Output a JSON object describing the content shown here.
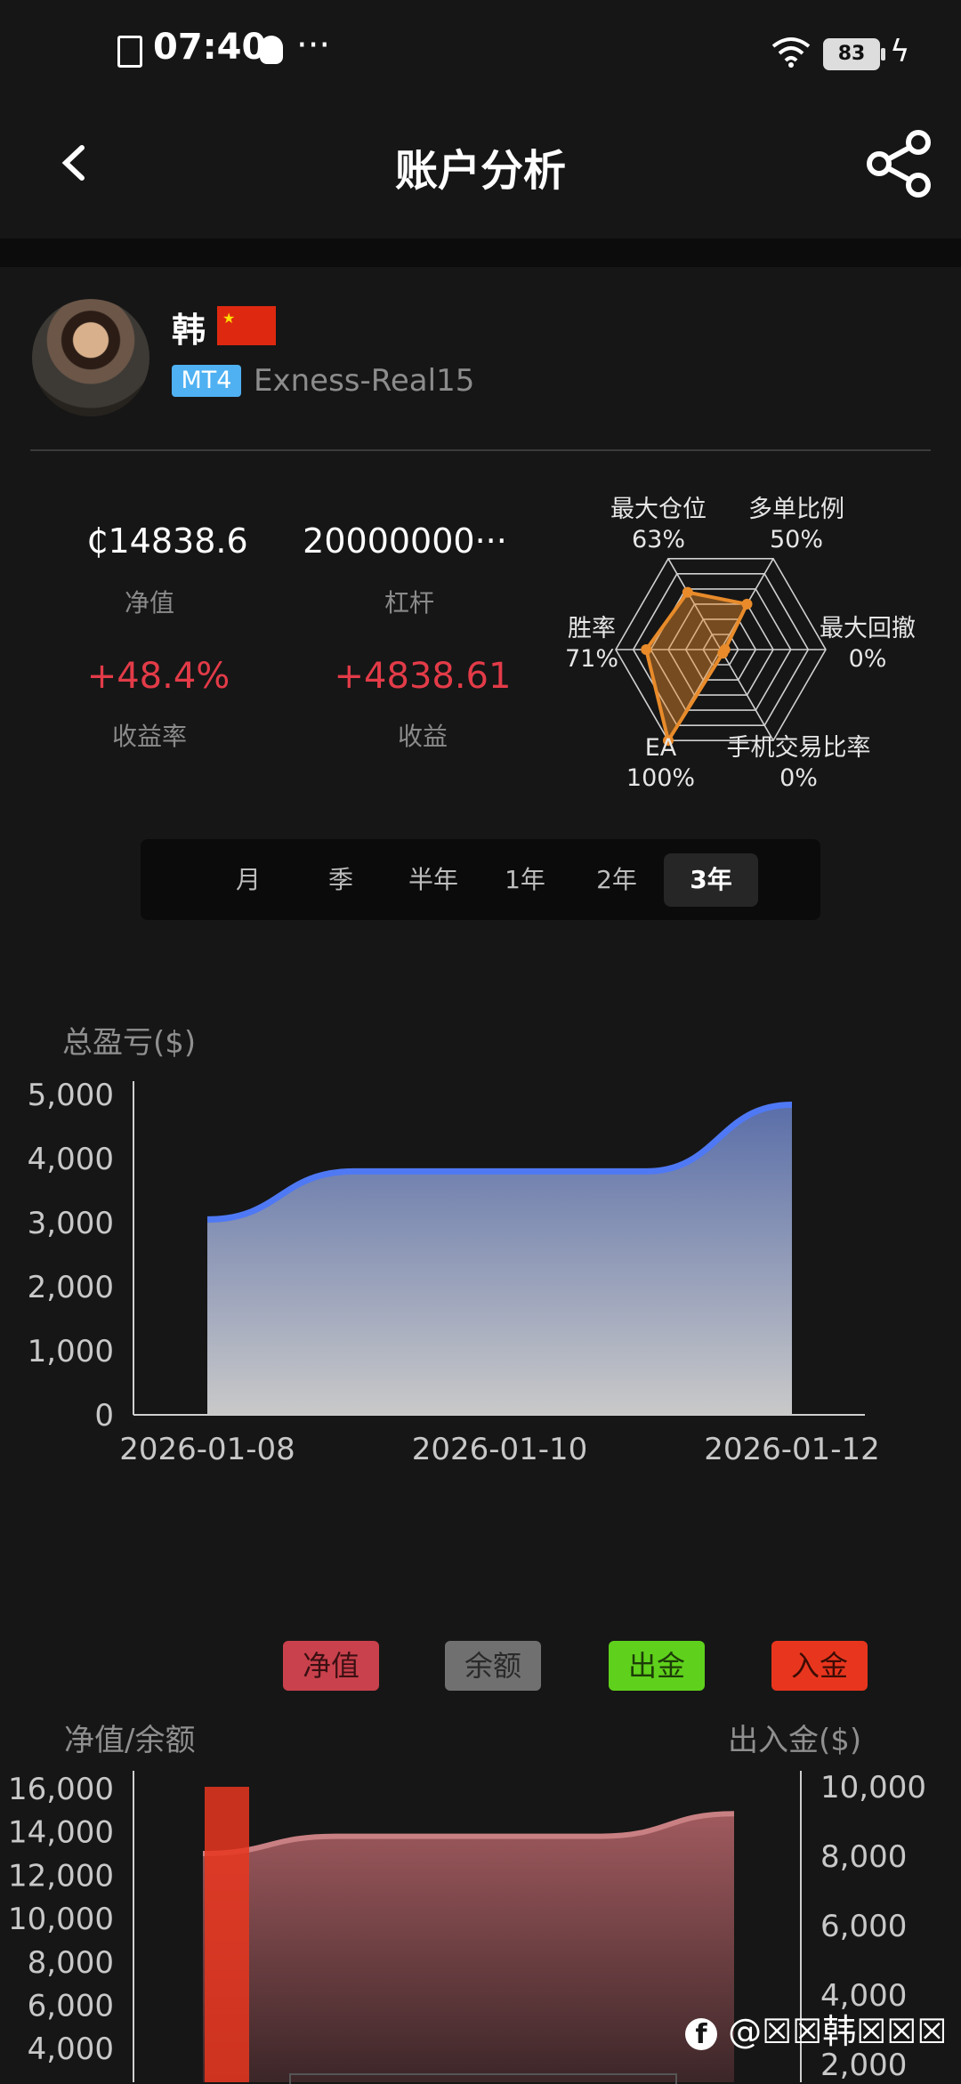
{
  "status_bar": {
    "time": "07:40",
    "more": "···",
    "battery": "83"
  },
  "header": {
    "title": "账户分析"
  },
  "profile": {
    "name": "韩",
    "platform_badge": "MT4",
    "server": "Exness-Real15"
  },
  "stats": {
    "equity_value": "₵14838.6",
    "equity_label": "净值",
    "leverage_value": "20000000···",
    "leverage_label": "杠杆",
    "return_rate_value": "+48.4%",
    "return_rate_label": "收益率",
    "profit_value": "+4838.61",
    "profit_label": "收益"
  },
  "radar": {
    "items": [
      {
        "label": "最大仓位",
        "value_text": "63%",
        "value": 63
      },
      {
        "label": "多单比例",
        "value_text": "50%",
        "value": 50
      },
      {
        "label": "最大回撤",
        "value_text": "0%",
        "value": 0
      },
      {
        "label": "手机交易比率",
        "value_text": "0%",
        "value": 0
      },
      {
        "label": "EA",
        "value_text": "100%",
        "value": 100
      },
      {
        "label": "胜率",
        "value_text": "71%",
        "value": 71
      }
    ],
    "color": "#e98b2a"
  },
  "tabs": [
    "月",
    "季",
    "半年",
    "1年",
    "2年",
    "3年"
  ],
  "active_tab": "3年",
  "chart_data": [
    {
      "type": "area",
      "title": "总盈亏($)",
      "x": [
        "2026-01-08",
        "2026-01-09",
        "2026-01-10",
        "2026-01-11",
        "2026-01-12"
      ],
      "x_ticks": [
        "2026-01-08",
        "2026-01-10",
        "2026-01-12"
      ],
      "values": [
        3050,
        3800,
        3800,
        3800,
        4840
      ],
      "ylim": [
        0,
        5000
      ],
      "y_ticks": [
        "0",
        "1,000",
        "2,000",
        "3,000",
        "4,000",
        "5,000"
      ],
      "line_color": "#4f79f4"
    },
    {
      "type": "area",
      "legend": [
        {
          "label": "净值",
          "color": "#c9414c"
        },
        {
          "label": "余额",
          "color": "#707070"
        },
        {
          "label": "出金",
          "color": "#5fd11c"
        },
        {
          "label": "入金",
          "color": "#e8361e"
        }
      ],
      "ylabel_left": "净值/余额",
      "ylabel_right": "出入金($)",
      "y_ticks_left": [
        "16,000",
        "14,000",
        "12,000",
        "10,000",
        "8,000",
        "6,000",
        "4,000"
      ],
      "y_ticks_right": [
        "10,000",
        "8,000",
        "6,000",
        "4,000",
        "2,000"
      ],
      "equity_values": [
        13000,
        13800,
        13800,
        13800,
        14838.6
      ],
      "deposit_value": 10000
    }
  ],
  "watermark": "@☒☒韩☒☒☒"
}
